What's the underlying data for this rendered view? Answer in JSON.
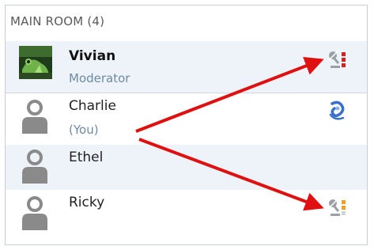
{
  "room": {
    "title": "MAIN ROOM",
    "count": "(4)"
  },
  "participants": [
    {
      "name": "Vivian",
      "role": "Moderator",
      "status_icon": "mic-off-icon-red"
    },
    {
      "name": "Charlie",
      "role": "(You)",
      "status_icon": "mic-on-icon-blue"
    },
    {
      "name": "Ethel",
      "role": "",
      "status_icon": ""
    },
    {
      "name": "Ricky",
      "role": "",
      "status_icon": "mic-off-icon-orange"
    }
  ],
  "colors": {
    "accent": "#3b6fcc",
    "muted_red": "#d42020",
    "muted_orange": "#f0a020",
    "arrow": "#e01010",
    "row_alt": "#eef3f9"
  }
}
